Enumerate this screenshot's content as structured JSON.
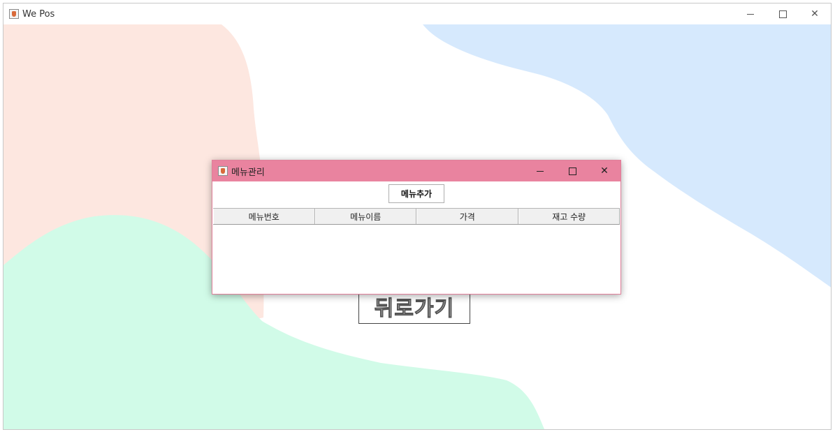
{
  "window": {
    "title": "We Pos",
    "icon": "java-cup-icon"
  },
  "colors": {
    "pink_blob": "#fde7e0",
    "green_blob": "#d1fbe8",
    "blue_blob": "#d6e9fd",
    "dialog_titlebar": "#e9839f"
  },
  "back_button": {
    "label": "뒤로가기"
  },
  "dialog": {
    "title": "메뉴관리",
    "icon": "java-cup-icon",
    "add_button": "메뉴추가",
    "table": {
      "columns": [
        "메뉴번호",
        "메뉴이름",
        "가격",
        "재고 수량"
      ],
      "rows": []
    }
  }
}
